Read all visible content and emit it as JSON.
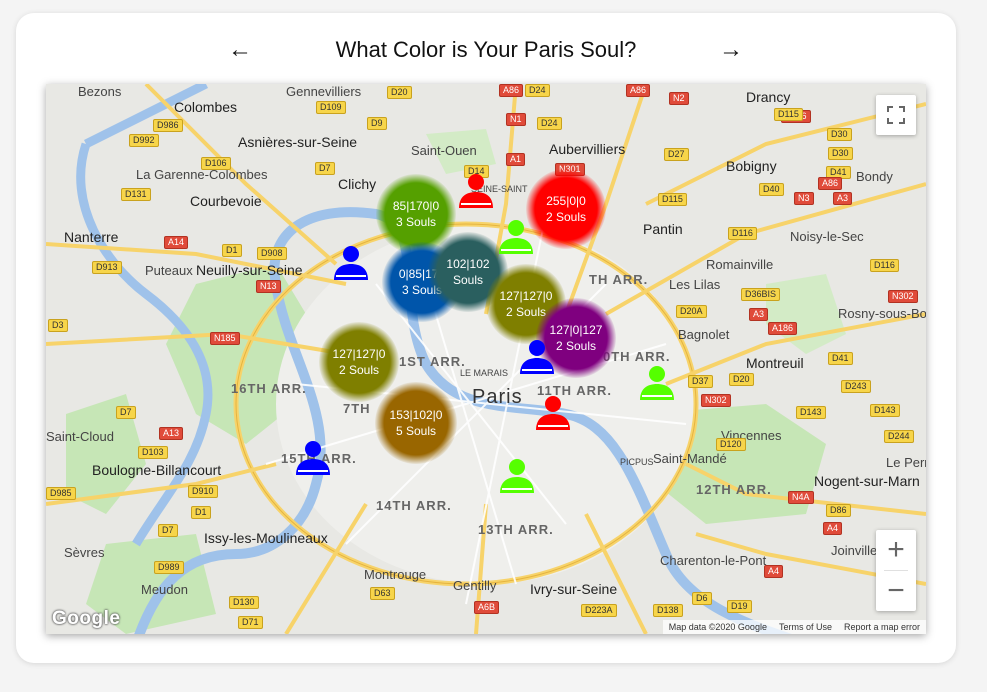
{
  "header": {
    "title": "What Color is Your Paris Soul?",
    "prev_label": "←",
    "next_label": "→"
  },
  "map": {
    "places": [
      {
        "name": "Bezons",
        "cls": ""
      },
      {
        "name": "Gennevilliers",
        "cls": ""
      },
      {
        "name": "Colombes",
        "cls": "big"
      },
      {
        "name": "Asnières-sur-Seine",
        "cls": "big"
      },
      {
        "name": "Saint-Ouen",
        "cls": ""
      },
      {
        "name": "Aubervilliers",
        "cls": "big"
      },
      {
        "name": "Drancy",
        "cls": "big"
      },
      {
        "name": "Bobigny",
        "cls": "big"
      },
      {
        "name": "Bondy",
        "cls": ""
      },
      {
        "name": "La Garenne-Colombes",
        "cls": ""
      },
      {
        "name": "Courbevoie",
        "cls": "big"
      },
      {
        "name": "Clichy",
        "cls": "big"
      },
      {
        "name": "Pantin",
        "cls": "big"
      },
      {
        "name": "Noisy-le-Sec",
        "cls": ""
      },
      {
        "name": "Nanterre",
        "cls": "big"
      },
      {
        "name": "Puteaux",
        "cls": ""
      },
      {
        "name": "Neuilly-sur-Seine",
        "cls": "big"
      },
      {
        "name": "Romainville",
        "cls": ""
      },
      {
        "name": "Les Lilas",
        "cls": ""
      },
      {
        "name": "Rosny-sous-Bo",
        "cls": ""
      },
      {
        "name": "Bagnolet",
        "cls": ""
      },
      {
        "name": "Montreuil",
        "cls": "big"
      },
      {
        "name": "16TH ARR.",
        "cls": "arr"
      },
      {
        "name": "1ST ARR.",
        "cls": "arr"
      },
      {
        "name": "7TH",
        "cls": "arr"
      },
      {
        "name": "Paris",
        "cls": "paris"
      },
      {
        "name": "11TH ARR.",
        "cls": "arr"
      },
      {
        "name": "TH ARR.",
        "cls": "arr"
      },
      {
        "name": "0TH ARR.",
        "cls": "arr"
      },
      {
        "name": "Saint-Cloud",
        "cls": ""
      },
      {
        "name": "Boulogne-Billancourt",
        "cls": "big"
      },
      {
        "name": "15TH ARR.",
        "cls": "arr"
      },
      {
        "name": "Vincennes",
        "cls": ""
      },
      {
        "name": "Saint-Mandé",
        "cls": ""
      },
      {
        "name": "Le Perreu",
        "cls": ""
      },
      {
        "name": "12TH ARR.",
        "cls": "arr"
      },
      {
        "name": "Nogent-sur-Marn",
        "cls": "big"
      },
      {
        "name": "14TH ARR.",
        "cls": "arr"
      },
      {
        "name": "13TH ARR.",
        "cls": "arr"
      },
      {
        "name": "Issy-les-Moulineaux",
        "cls": "big"
      },
      {
        "name": "Sèvres",
        "cls": ""
      },
      {
        "name": "Charenton-le-Pont",
        "cls": ""
      },
      {
        "name": "Joinville-le-Po",
        "cls": ""
      },
      {
        "name": "Meudon",
        "cls": ""
      },
      {
        "name": "Montrouge",
        "cls": ""
      },
      {
        "name": "Gentilly",
        "cls": ""
      },
      {
        "name": "Ivry-sur-Seine",
        "cls": "big"
      },
      {
        "name": "LE MARAIS",
        "cls": ""
      },
      {
        "name": "PICPUS",
        "cls": ""
      },
      {
        "name": "SEINE-SAINT",
        "cls": ""
      }
    ],
    "roads": [
      "D20",
      "A86",
      "D24",
      "A86",
      "N2",
      "D109",
      "D9",
      "N1",
      "D24",
      "D986",
      "N186",
      "D115",
      "D30",
      "D992",
      "D106",
      "D7",
      "D14",
      "A1",
      "N301",
      "D27",
      "D30",
      "D41",
      "A86",
      "D40",
      "D131",
      "D115",
      "A3",
      "N3",
      "D1",
      "D116",
      "D908",
      "A14",
      "D913",
      "N13",
      "D116",
      "N302",
      "D36BIS",
      "D20A",
      "A3",
      "A186",
      "D3",
      "N185",
      "D41",
      "D243",
      "D37",
      "D20",
      "D7",
      "N302",
      "D143",
      "D143",
      "D244",
      "D120",
      "D103",
      "A13",
      "D910",
      "D985",
      "N4A",
      "D86",
      "A4",
      "D1",
      "D7",
      "D989",
      "D63",
      "D130",
      "D71",
      "A6B",
      "D223A",
      "D138",
      "D6",
      "D19",
      "A4"
    ],
    "souls": [
      {
        "label": "85|170|0",
        "count": "3 Souls",
        "color": "#55a000"
      },
      {
        "label": "255|0|0",
        "count": "2 Souls",
        "color": "#ff0000"
      },
      {
        "label": "0|85|170",
        "count": "3 Souls",
        "color": "#0055aa"
      },
      {
        "label": "102|102",
        "count": "Souls",
        "color": "#2a5f5f"
      },
      {
        "label": "127|127|0",
        "count": "2 Souls",
        "color": "#7f7f00"
      },
      {
        "label": "127|0|127",
        "count": "2 Souls",
        "color": "#7f007f"
      },
      {
        "label": "127|127|0",
        "count": "2 Souls",
        "color": "#7f7f00"
      },
      {
        "label": "153|102|0",
        "count": "5 Souls",
        "color": "#996600"
      }
    ],
    "people": [
      {
        "color": "#ff0000"
      },
      {
        "color": "#55ff00"
      },
      {
        "color": "#0000ff"
      },
      {
        "color": "#0000ff"
      },
      {
        "color": "#55ff00"
      },
      {
        "color": "#ff0000"
      },
      {
        "color": "#0000ff"
      },
      {
        "color": "#55ff00"
      }
    ],
    "zoom_in": "+",
    "zoom_out": "−",
    "google": "Google",
    "footer": {
      "map_data": "Map data ©2020 Google",
      "terms": "Terms of Use",
      "report": "Report a map error"
    }
  }
}
